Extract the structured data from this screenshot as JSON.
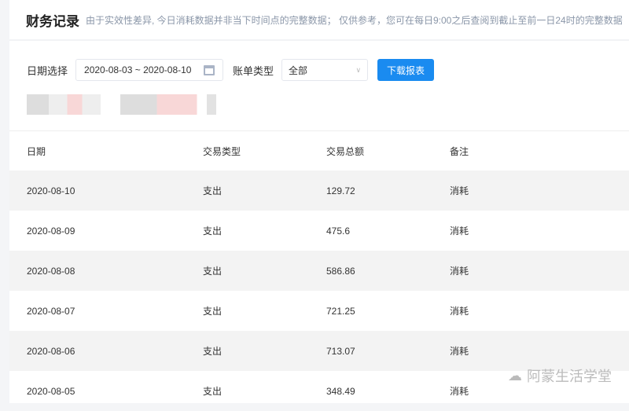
{
  "header": {
    "title": "财务记录",
    "notice": "由于实效性差异, 今日消耗数据并非当下时间点的完整数据； 仅供参考，您可在每日9:00之后查阅到截止至前一日24时的完整数据"
  },
  "filters": {
    "date_label": "日期选择",
    "date_range": "2020-08-03 ~ 2020-08-10",
    "type_label": "账单类型",
    "type_value": "全部",
    "download_label": "下载报表"
  },
  "table": {
    "columns": [
      "日期",
      "交易类型",
      "交易总额",
      "备注"
    ],
    "rows": [
      [
        "2020-08-10",
        "支出",
        "129.72",
        "消耗"
      ],
      [
        "2020-08-09",
        "支出",
        "475.6",
        "消耗"
      ],
      [
        "2020-08-08",
        "支出",
        "586.86",
        "消耗"
      ],
      [
        "2020-08-07",
        "支出",
        "721.25",
        "消耗"
      ],
      [
        "2020-08-06",
        "支出",
        "713.07",
        "消耗"
      ],
      [
        "2020-08-05",
        "支出",
        "348.49",
        "消耗"
      ]
    ]
  },
  "watermark": "阿蒙生活学堂"
}
